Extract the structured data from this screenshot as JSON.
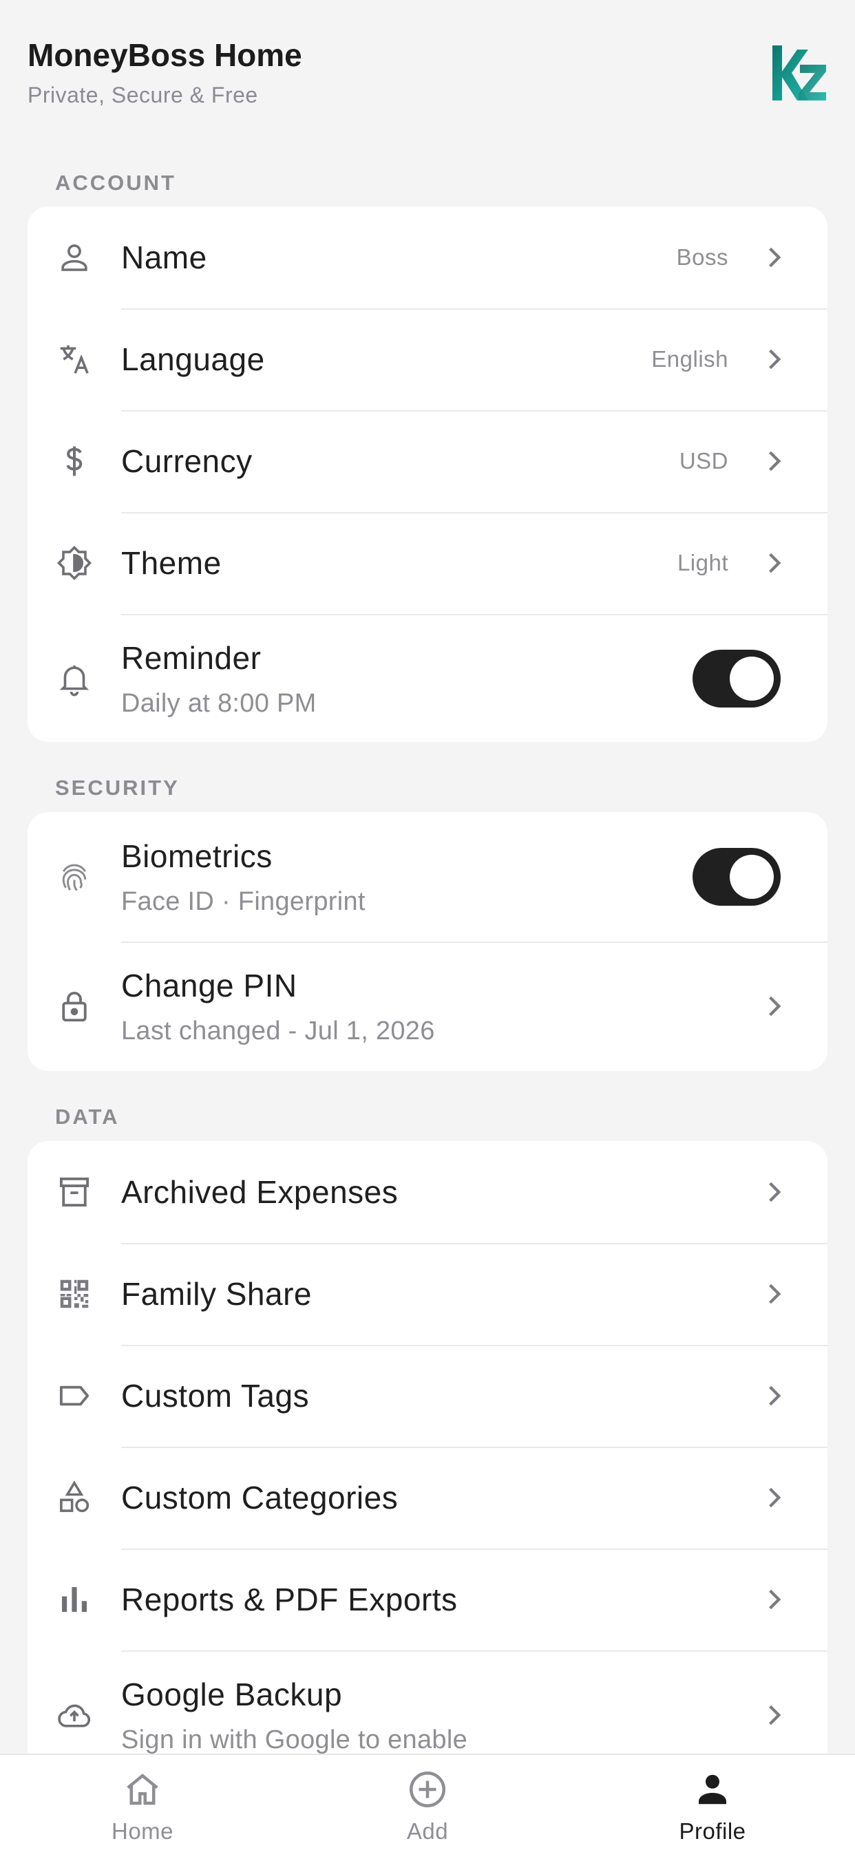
{
  "header": {
    "title": "MoneyBoss Home",
    "subtitle": "Private, Secure & Free",
    "logo_icon": "kz-logo",
    "logo_colors": [
      "#0f766e",
      "#14b8a6"
    ]
  },
  "sections": {
    "account": {
      "label": "ACCOUNT",
      "items": [
        {
          "icon": "person-icon",
          "title": "Name",
          "value": "Boss"
        },
        {
          "icon": "translate-icon",
          "title": "Language",
          "value": "English"
        },
        {
          "icon": "dollar-icon",
          "title": "Currency",
          "value": "USD"
        },
        {
          "icon": "brightness-icon",
          "title": "Theme",
          "value": "Light"
        },
        {
          "icon": "bell-icon",
          "title": "Reminder",
          "subtitle": "Daily at 8:00 PM",
          "toggle": true
        }
      ]
    },
    "security": {
      "label": "SECURITY",
      "items": [
        {
          "icon": "fingerprint-icon",
          "title": "Biometrics",
          "subtitle": "Face ID · Fingerprint",
          "toggle": true
        },
        {
          "icon": "lock-icon",
          "title": "Change PIN",
          "subtitle": "Last changed - Jul 1, 2026"
        }
      ]
    },
    "data": {
      "label": "DATA",
      "items": [
        {
          "icon": "archive-icon",
          "title": "Archived Expenses"
        },
        {
          "icon": "qr-code-icon",
          "title": "Family Share"
        },
        {
          "icon": "tag-icon",
          "title": "Custom Tags"
        },
        {
          "icon": "shapes-icon",
          "title": "Custom Categories"
        },
        {
          "icon": "bar-chart-icon",
          "title": "Reports & PDF Exports"
        },
        {
          "icon": "cloud-upload-icon",
          "title": "Google Backup",
          "subtitle": "Sign in with Google to enable"
        }
      ]
    }
  },
  "bottom_nav": {
    "items": [
      {
        "icon": "home-icon",
        "label": "Home",
        "active": false
      },
      {
        "icon": "add-circle-icon",
        "label": "Add",
        "active": false
      },
      {
        "icon": "profile-icon",
        "label": "Profile",
        "active": true
      }
    ]
  },
  "colors": {
    "background": "#f4f4f5",
    "card": "#ffffff",
    "muted_text": "#8e8e93",
    "toggle_on": "#202020"
  }
}
